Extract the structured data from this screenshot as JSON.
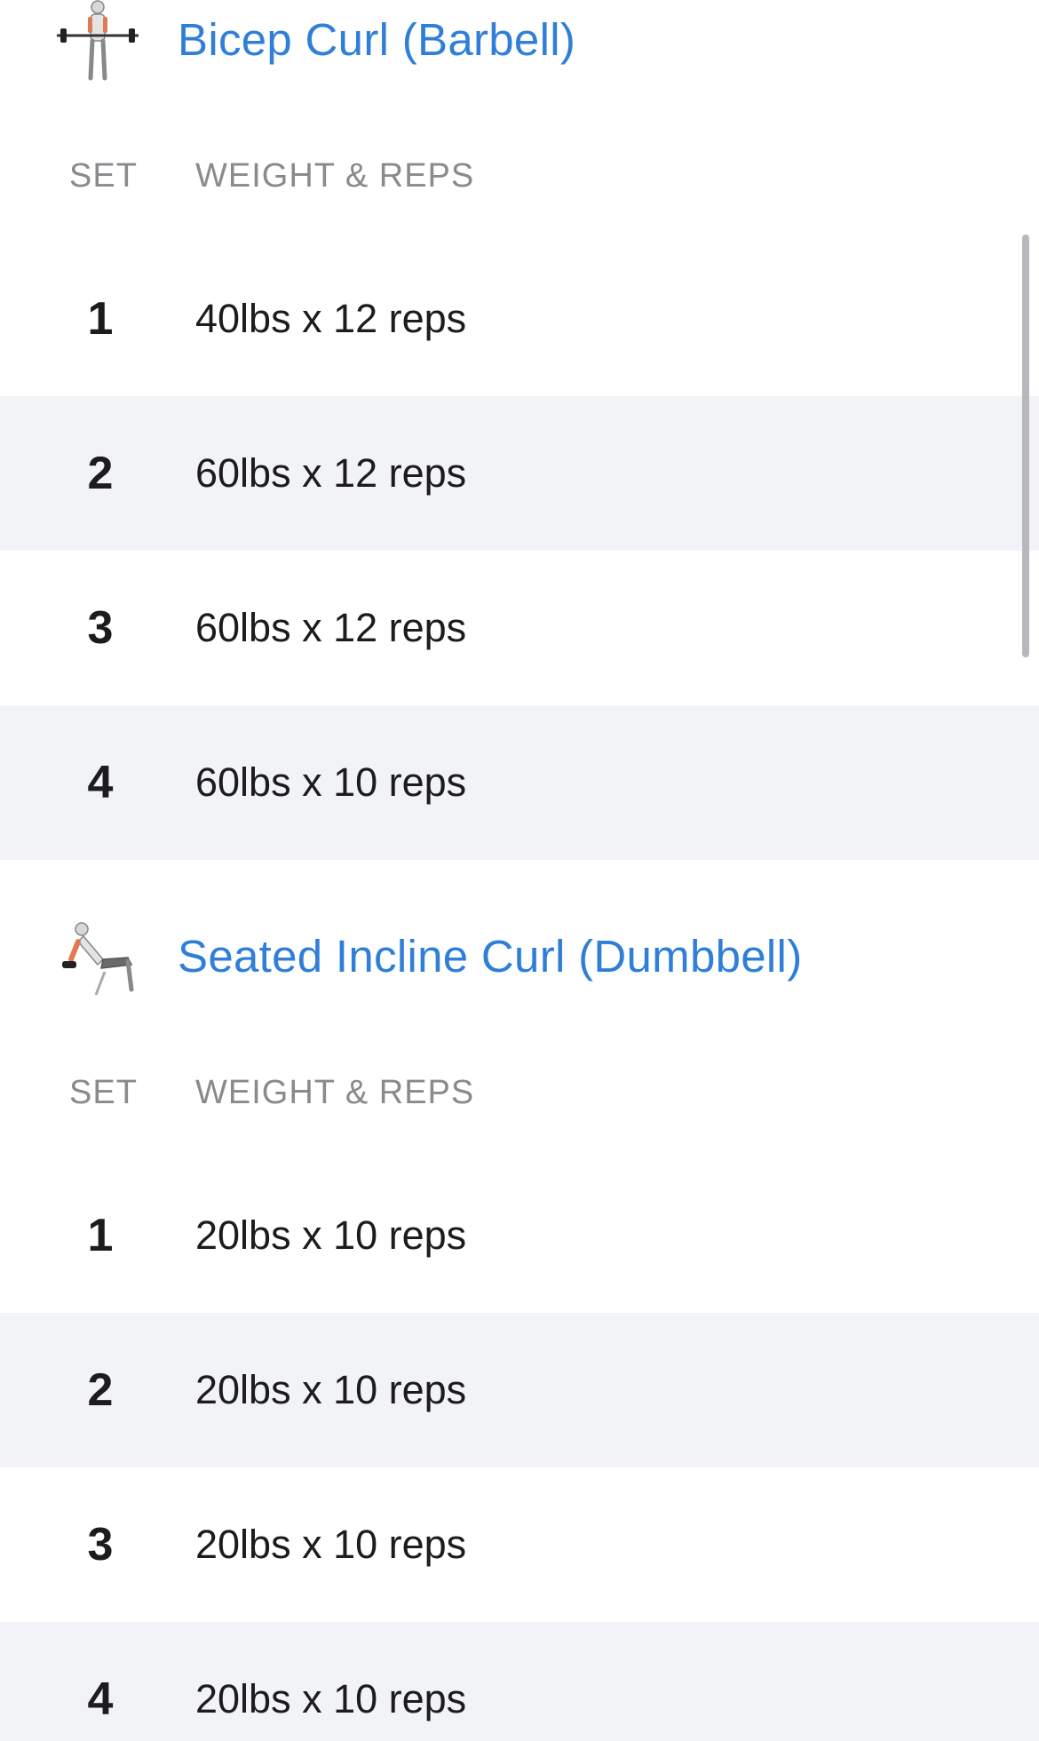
{
  "colors": {
    "accent": "#2f7fd9",
    "row_alt_bg": "#f2f3f6",
    "header_text": "#8a8a8e",
    "body_text": "#1c1c1e"
  },
  "exercises": [
    {
      "title": "Bicep Curl (Barbell)",
      "thumbnail_icon": "barbell-curl-figure-icon",
      "columns": {
        "set": "SET",
        "weight_reps": "WEIGHT & REPS"
      },
      "sets": [
        {
          "set": "1",
          "weight_reps": "40lbs x 12 reps"
        },
        {
          "set": "2",
          "weight_reps": "60lbs x 12 reps"
        },
        {
          "set": "3",
          "weight_reps": "60lbs x 12 reps"
        },
        {
          "set": "4",
          "weight_reps": "60lbs x 10 reps"
        }
      ]
    },
    {
      "title": "Seated Incline Curl (Dumbbell)",
      "thumbnail_icon": "incline-curl-figure-icon",
      "columns": {
        "set": "SET",
        "weight_reps": "WEIGHT & REPS"
      },
      "sets": [
        {
          "set": "1",
          "weight_reps": "20lbs x 10 reps"
        },
        {
          "set": "2",
          "weight_reps": "20lbs x 10 reps"
        },
        {
          "set": "3",
          "weight_reps": "20lbs x 10 reps"
        },
        {
          "set": "4",
          "weight_reps": "20lbs x 10 reps"
        }
      ]
    }
  ]
}
